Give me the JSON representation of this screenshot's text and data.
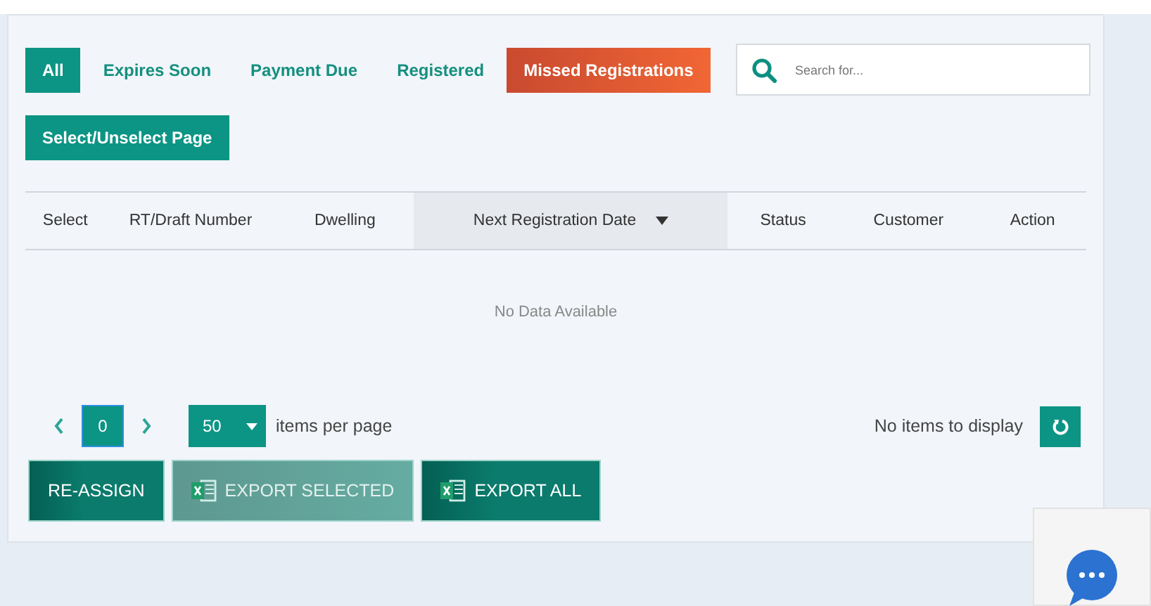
{
  "tabs": [
    {
      "label": "All",
      "selected": true,
      "kind": "plain"
    },
    {
      "label": "Expires Soon",
      "selected": false,
      "kind": "plain"
    },
    {
      "label": "Payment Due",
      "selected": false,
      "kind": "plain"
    },
    {
      "label": "Registered",
      "selected": false,
      "kind": "plain"
    },
    {
      "label": "Missed Registrations",
      "selected": false,
      "kind": "alert"
    }
  ],
  "search": {
    "placeholder": "Search for..."
  },
  "select_page_button": "Select/Unselect Page",
  "table": {
    "columns": [
      {
        "label": "Select",
        "sorted": false
      },
      {
        "label": "RT/Draft Number",
        "sorted": false
      },
      {
        "label": "Dwelling",
        "sorted": false
      },
      {
        "label": "Next Registration Date",
        "sorted": true
      },
      {
        "label": "Status",
        "sorted": false
      },
      {
        "label": "Customer",
        "sorted": false
      },
      {
        "label": "Action",
        "sorted": false
      }
    ],
    "empty_message": "No Data Available"
  },
  "pager": {
    "page": "0",
    "page_size": "50",
    "page_size_label": "items per page",
    "info": "No items to display"
  },
  "actions": [
    {
      "label": "RE-ASSIGN",
      "kind": "plain",
      "disabled": false
    },
    {
      "label": "EXPORT SELECTED",
      "kind": "excel",
      "disabled": true
    },
    {
      "label": "EXPORT ALL",
      "kind": "excel",
      "disabled": false
    }
  ]
}
